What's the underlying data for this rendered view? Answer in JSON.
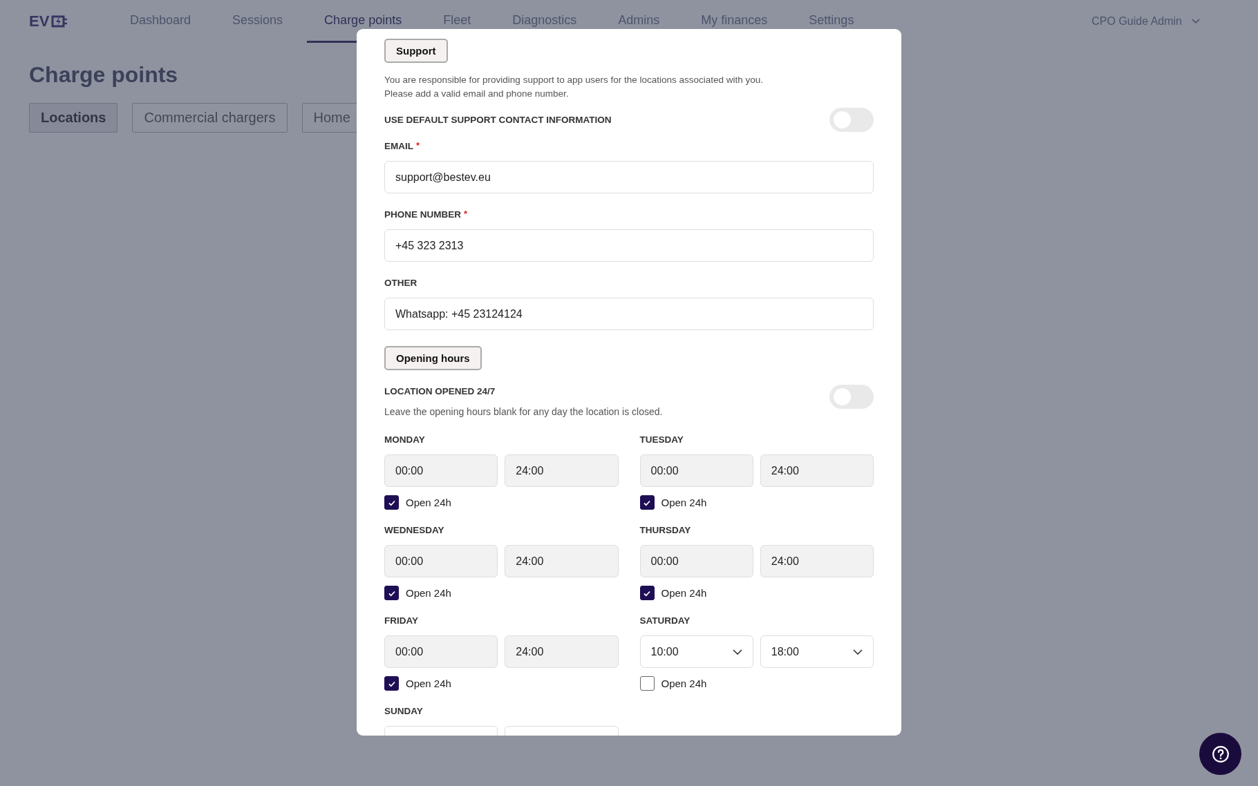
{
  "nav": {
    "logo": "EV",
    "items": [
      {
        "label": "Dashboard",
        "selected": false
      },
      {
        "label": "Sessions",
        "selected": false
      },
      {
        "label": "Charge points",
        "selected": true
      },
      {
        "label": "Fleet",
        "selected": false
      },
      {
        "label": "Diagnostics",
        "selected": false
      },
      {
        "label": "Admins",
        "selected": false
      },
      {
        "label": "My finances",
        "selected": false
      },
      {
        "label": "Settings",
        "selected": false
      }
    ],
    "user": "CPO Guide Admin"
  },
  "page": {
    "title": "Charge points",
    "tabs": [
      {
        "label": "Locations",
        "selected": true
      },
      {
        "label": "Commercial chargers",
        "selected": false
      },
      {
        "label": "Home",
        "selected": false
      }
    ]
  },
  "modal": {
    "support": {
      "heading": "Support",
      "description": [
        "You are responsible for providing support to app users for the locations associated with you.",
        "Please add a valid email and phone number."
      ],
      "default_toggle": {
        "label": "USE DEFAULT SUPPORT CONTACT INFORMATION",
        "on": false
      },
      "fields": [
        {
          "label": "EMAIL",
          "required_mark": "*",
          "value": "support@bestev.eu"
        },
        {
          "label": "PHONE NUMBER",
          "required_mark": "*",
          "value": "+45 323 2313"
        },
        {
          "label": "OTHER",
          "value": "Whatsapp: +45 23124124"
        }
      ]
    },
    "opening_hours": {
      "heading": "Opening hours",
      "always_open": {
        "label": "LOCATION OPENED 24/7",
        "on": false
      },
      "hint": "Leave the opening hours blank for any day the location is closed.",
      "days": [
        {
          "day": "MONDAY",
          "kind": "fixed",
          "from": "00:00",
          "to": "24:00",
          "open_label": "Open 24h",
          "open_24h": true
        },
        {
          "day": "TUESDAY",
          "kind": "fixed",
          "from": "00:00",
          "to": "24:00",
          "open_label": "Open 24h",
          "open_24h": true
        },
        {
          "day": "WEDNESDAY",
          "kind": "fixed",
          "from": "00:00",
          "to": "24:00",
          "open_label": "Open 24h",
          "open_24h": true
        },
        {
          "day": "THURSDAY",
          "kind": "fixed",
          "from": "00:00",
          "to": "24:00",
          "open_label": "Open 24h",
          "open_24h": true
        },
        {
          "day": "FRIDAY",
          "kind": "fixed",
          "from": "00:00",
          "to": "24:00",
          "open_label": "Open 24h",
          "open_24h": true
        },
        {
          "day": "SATURDAY",
          "kind": "select",
          "from": "10:00",
          "to": "18:00",
          "open_label": "Open 24h",
          "open_24h": false
        },
        {
          "day": "SUNDAY",
          "kind": "blank"
        }
      ]
    }
  }
}
